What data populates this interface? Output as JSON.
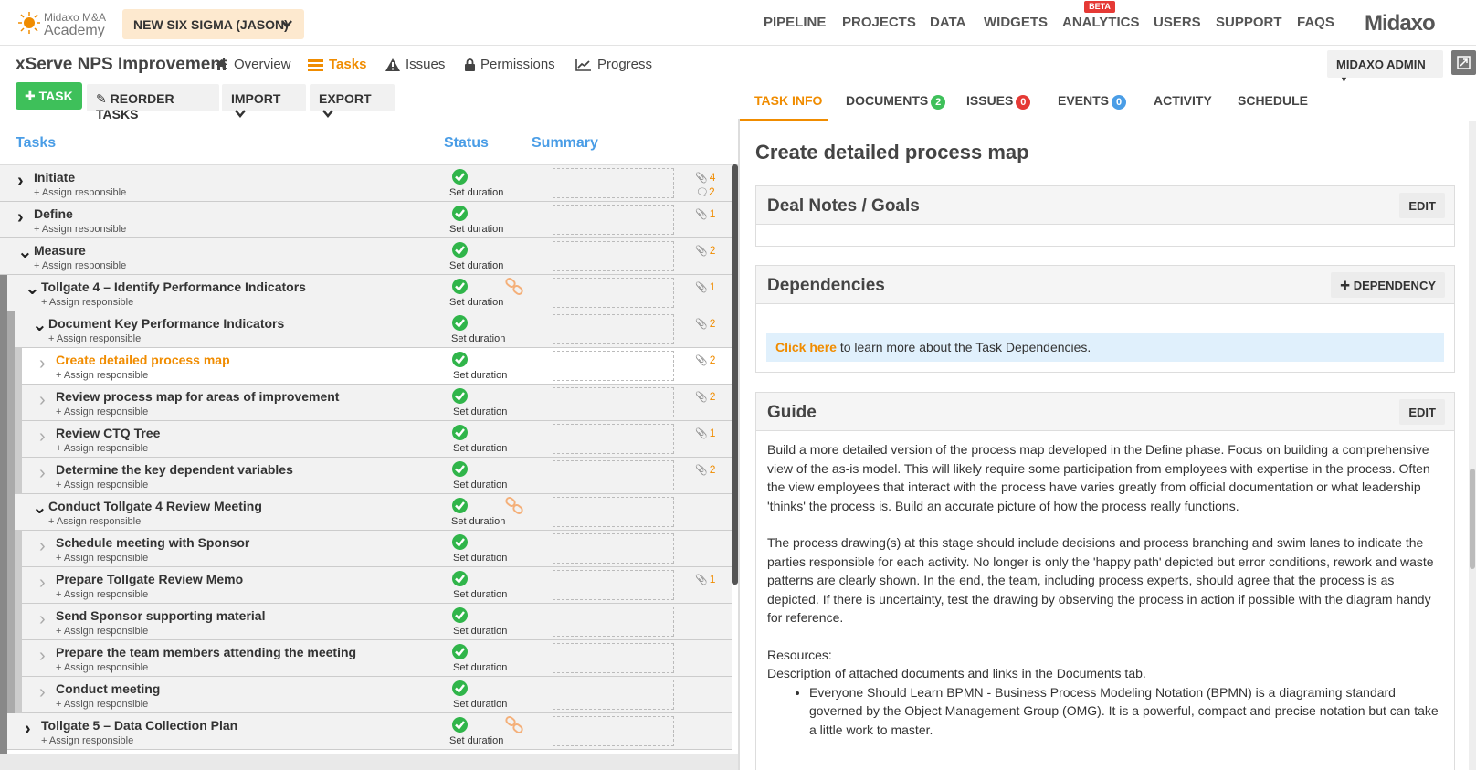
{
  "brand": {
    "logo_line1": "Midaxo M&A",
    "logo_line2": "Academy",
    "wordmark": "Midaxo"
  },
  "project_switcher": {
    "label": "NEW SIX SIGMA (JASON)"
  },
  "nav": {
    "items": [
      "PIPELINE",
      "PROJECTS",
      "DATA",
      "WIDGETS",
      "ANALYTICS",
      "USERS",
      "SUPPORT",
      "FAQS"
    ],
    "beta_badge": "BETA"
  },
  "project": {
    "title": "xServe NPS Improvement",
    "tabs": [
      "Overview",
      "Tasks",
      "Issues",
      "Permissions",
      "Progress"
    ],
    "active_tab": "Tasks"
  },
  "user_menu": {
    "label": "MIDAXO ADMIN"
  },
  "toolbar": {
    "add_task": "TASK",
    "reorder": "REORDER TASKS",
    "import": "IMPORT",
    "export": "EXPORT"
  },
  "task_table": {
    "headers": {
      "tasks": "Tasks",
      "status": "Status",
      "summary": "Summary"
    },
    "assign_text": "+ Assign responsible",
    "status_text": "Set duration",
    "rows": [
      {
        "name": "Initiate",
        "expander": "collapsed",
        "attachments": "4",
        "comments": "2",
        "has_link": false
      },
      {
        "name": "Define",
        "expander": "collapsed",
        "attachments": "1",
        "comments": "",
        "has_link": false
      },
      {
        "name": "Measure",
        "expander": "expanded",
        "attachments": "2",
        "comments": "",
        "has_link": false
      },
      {
        "name": "Tollgate 4 – Identify Performance Indicators",
        "expander": "expanded",
        "attachments": "1",
        "comments": "",
        "has_link": true
      },
      {
        "name": "Document Key Performance Indicators",
        "expander": "expanded",
        "attachments": "2",
        "comments": "",
        "has_link": false
      },
      {
        "name": "Create detailed process map",
        "expander": "leaf",
        "attachments": "2",
        "comments": "",
        "has_link": false,
        "selected": true
      },
      {
        "name": "Review process map for areas of improvement",
        "expander": "leaf",
        "attachments": "2",
        "comments": "",
        "has_link": false
      },
      {
        "name": "Review CTQ Tree",
        "expander": "leaf",
        "attachments": "1",
        "comments": "",
        "has_link": false
      },
      {
        "name": "Determine the key dependent variables",
        "expander": "leaf",
        "attachments": "2",
        "comments": "",
        "has_link": false
      },
      {
        "name": "Conduct Tollgate 4 Review Meeting",
        "expander": "expanded",
        "attachments": "",
        "comments": "",
        "has_link": true
      },
      {
        "name": "Schedule meeting with Sponsor",
        "expander": "leaf",
        "attachments": "",
        "comments": "",
        "has_link": false
      },
      {
        "name": "Prepare Tollgate Review Memo",
        "expander": "leaf",
        "attachments": "1",
        "comments": "",
        "has_link": false
      },
      {
        "name": "Send Sponsor supporting material",
        "expander": "leaf",
        "attachments": "",
        "comments": "",
        "has_link": false
      },
      {
        "name": "Prepare the team members attending the meeting",
        "expander": "leaf",
        "attachments": "",
        "comments": "",
        "has_link": false
      },
      {
        "name": "Conduct meeting",
        "expander": "leaf",
        "attachments": "",
        "comments": "",
        "has_link": false
      },
      {
        "name": "Tollgate 5 – Data Collection Plan",
        "expander": "collapsed",
        "attachments": "",
        "comments": "",
        "has_link": true
      }
    ]
  },
  "detail_tabs": [
    {
      "label": "TASK INFO",
      "badge": ""
    },
    {
      "label": "DOCUMENTS",
      "badge": "2",
      "badge_color": "#3ec05a"
    },
    {
      "label": "ISSUES",
      "badge": "0",
      "badge_color": "#e53935"
    },
    {
      "label": "EVENTS",
      "badge": "0",
      "badge_color": "#4a9de6"
    },
    {
      "label": "ACTIVITY",
      "badge": ""
    },
    {
      "label": "SCHEDULE",
      "badge": ""
    }
  ],
  "detail": {
    "title": "Create detailed process map",
    "deal_notes": {
      "title": "Deal Notes / Goals",
      "edit": "EDIT"
    },
    "dependencies": {
      "title": "Dependencies",
      "add": "DEPENDENCY",
      "info_link": "Click here",
      "info_text": " to learn more about the Task Dependencies."
    },
    "guide": {
      "title": "Guide",
      "edit": "EDIT",
      "p1": "Build a more detailed version of the process map developed in the Define phase. Focus on building a comprehensive view of the as-is model. This will likely require some participation from employees with expertise in the process. Often the view employees that interact with the process have varies greatly from official documentation or what leadership 'thinks' the process is. Build an accurate picture of how the process really functions.",
      "p2": "The process drawing(s) at this stage should include decisions and process branching and swim lanes to indicate the parties responsible for each activity. No longer is only the 'happy path' depicted but error conditions, rework and waste patterns are clearly shown. In the end, the team, including process experts, should agree that the process is as depicted. If there is uncertainty, test the drawing by observing the process in action if possible with the diagram handy for reference.",
      "resources_label": "Resources:",
      "resources_desc": "Description of attached documents and links in the Documents tab.",
      "bullet1": "Everyone Should Learn BPMN - Business Process Modeling Notation (BPMN) is a diagraming standard governed by the Object Management Group (OMG). It is a powerful, compact and precise notation but can take a little work to master."
    }
  },
  "colors": {
    "accent": "#f08c00",
    "success": "#3ec05a",
    "link_blue": "#4a9de6"
  }
}
